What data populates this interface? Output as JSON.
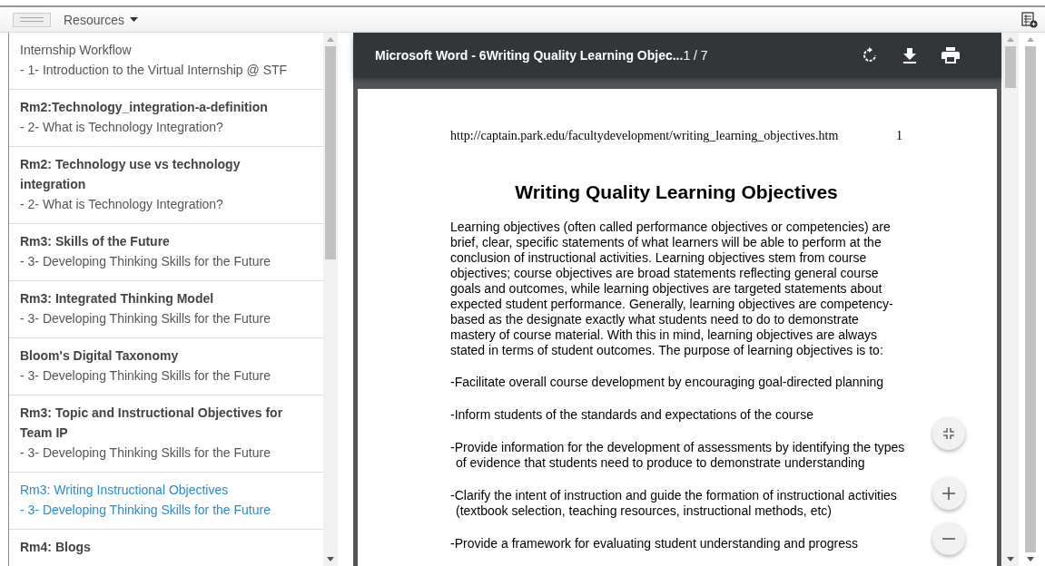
{
  "toolbar": {
    "menu_label": "Resources"
  },
  "sidebar": {
    "items": [
      {
        "title": "Internship Workflow",
        "subtitle": "- 1- Introduction to the Virtual Internship @ STF",
        "title_bold": false,
        "selected": false
      },
      {
        "title": "Rm2:Technology_integration-a-definition",
        "subtitle": "- 2- What is Technology Integration?",
        "title_bold": true,
        "selected": false
      },
      {
        "title": "Rm2: Technology use vs technology integration",
        "subtitle": "- 2- What is Technology Integration?",
        "title_bold": true,
        "selected": false
      },
      {
        "title": "Rm3: Skills of the Future",
        "subtitle": "- 3- Developing Thinking Skills for the Future",
        "title_bold": true,
        "selected": false
      },
      {
        "title": "Rm3: Integrated Thinking Model",
        "subtitle": "- 3- Developing Thinking Skills for the Future",
        "title_bold": true,
        "selected": false
      },
      {
        "title": "Bloom's Digital Taxonomy",
        "subtitle": "- 3- Developing Thinking Skills for the Future",
        "title_bold": true,
        "selected": false
      },
      {
        "title": "Rm3: Topic and Instructional Objectives for Team IP",
        "subtitle": "- 3- Developing Thinking Skills for the Future",
        "title_bold": true,
        "selected": false
      },
      {
        "title": "Rm3: Writing Instructional Objectives",
        "subtitle": "- 3- Developing Thinking Skills for the Future",
        "title_bold": false,
        "selected": true
      },
      {
        "title": "Rm4: Blogs",
        "title_bold": true,
        "selected": false
      }
    ]
  },
  "viewer": {
    "title": "Microsoft Word - 6Writing Quality Learning Objec...",
    "page_counter": "1 / 7",
    "document": {
      "header_url": "http://captain.park.edu/facultydevelopment/writing_learning_objectives.htm",
      "header_page": "1",
      "heading": "Writing Quality Learning Objectives",
      "paragraph": "Learning objectives (often called performance objectives or competencies) are brief, clear, specific statements of what learners will be able to perform at the conclusion of instructional activities. Learning objectives stem from course objectives; course objectives are broad statements reflecting general course goals and outcomes, while learning objectives are targeted statements about expected student performance. Generally, learning objectives are competency-based as the designate exactly what students need to do to demonstrate mastery of course material. With this in mind, learning objectives are always stated in terms of student outcomes. The purpose of learning objectives is to:",
      "bullets": [
        "-Facilitate overall course development by encouraging goal-directed planning",
        "-Inform students of the standards and expectations of the course",
        "-Provide information for the development of assessments by identifying the types of evidence that students need to produce to demonstrate understanding",
        "-Clarify the intent of instruction and guide the formation of instructional activities (textbook selection, teaching resources, instructional methods, etc)",
        "-Provide a framework for evaluating student understanding and progress"
      ]
    }
  }
}
